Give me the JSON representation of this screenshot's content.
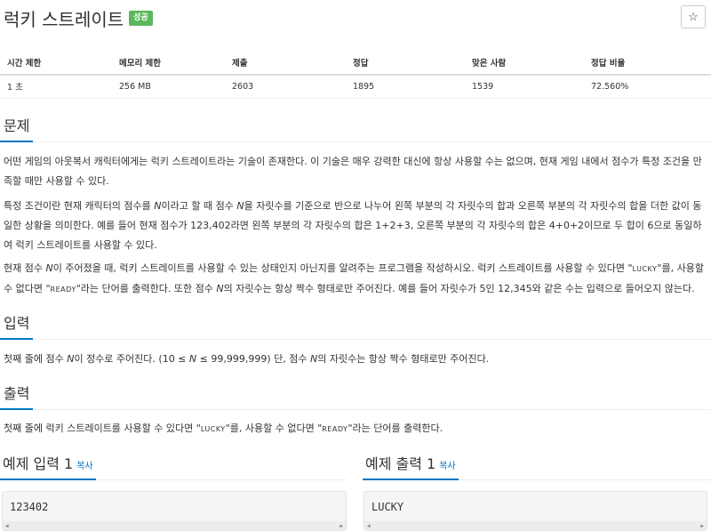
{
  "problem": {
    "title": "럭키 스트레이트",
    "status_badge": "성공"
  },
  "icons": {
    "star": "star-icon"
  },
  "info_table": {
    "headers": [
      "시간 제한",
      "메모리 제한",
      "제출",
      "정답",
      "맞은 사람",
      "정답 비율"
    ],
    "values": [
      "1 초",
      "256 MB",
      "2603",
      "1895",
      "1539",
      "72.560%"
    ]
  },
  "sections": {
    "problem_heading": "문제",
    "input_heading": "입력",
    "output_heading": "출력"
  },
  "description": {
    "p1": "어떤 게임의 아웃복서 캐릭터에게는 럭키 스트레이트라는 기술이 존재한다. 이 기술은 매우 강력한 대신에 항상 사용할 수는 없으며, 현재 게임 내에서 점수가 특정 조건을 만족할 때만 사용할 수 있다.",
    "p2_a": "특정 조건이란 현재 캐릭터의 점수를 ",
    "p2_var1": "N",
    "p2_b": "이라고 할 때 점수 ",
    "p2_var2": "N",
    "p2_c": "을 자릿수를 기준으로 반으로 나누어 왼쪽 부분의 각 자릿수의 합과 오른쪽 부분의 각 자릿수의 합을 더한 값이 동일한 상황을 의미한다. 예를 들어 현재 점수가 123,402라면 왼쪽 부분의 각 자릿수의 합은 1+2+3, 오른쪽 부분의 각 자릿수의 합은 4+0+2이므로 두 합이 6으로 동일하여 럭키 스트레이트를 사용할 수 있다.",
    "p3_a": "현재 점수 ",
    "p3_var1": "N",
    "p3_b": "이 주어졌을 때, 럭키 스트레이트를 사용할 수 있는 상태인지 아닌지를 알려주는 프로그램을 작성하시오. 럭키 스트레이트를 사용할 수 있다면 \"",
    "p3_lucky": "LUCKY",
    "p3_c": "\"를, 사용할 수 없다면 \"",
    "p3_ready": "READY",
    "p3_d": "\"라는 단어를 출력한다. 또한 점수 ",
    "p3_var2": "N",
    "p3_e": "의 자릿수는 항상 짝수 형태로만 주어진다. 예를 들어 자릿수가 5인 12,345와 같은 수는 입력으로 들어오지 않는다."
  },
  "input_desc": {
    "a": "첫째 줄에 점수 ",
    "var1": "N",
    "b": "이 정수로 주어진다. (10 ≤ ",
    "var2": "N",
    "c": " ≤ 99,999,999) 단, 점수 ",
    "var3": "N",
    "d": "의 자릿수는 항상 짝수 형태로만 주어진다."
  },
  "output_desc": {
    "a": "첫째 줄에 럭키 스트레이트를 사용할 수 있다면 \"",
    "lucky": "LUCKY",
    "b": "\"를, 사용할 수 없다면 \"",
    "ready": "READY",
    "c": "\"라는 단어를 출력한다."
  },
  "samples": {
    "input_heading": "예제 입력 1",
    "output_heading": "예제 출력 1",
    "copy_label": "복사",
    "input_value": "123402",
    "output_value": "LUCKY"
  }
}
